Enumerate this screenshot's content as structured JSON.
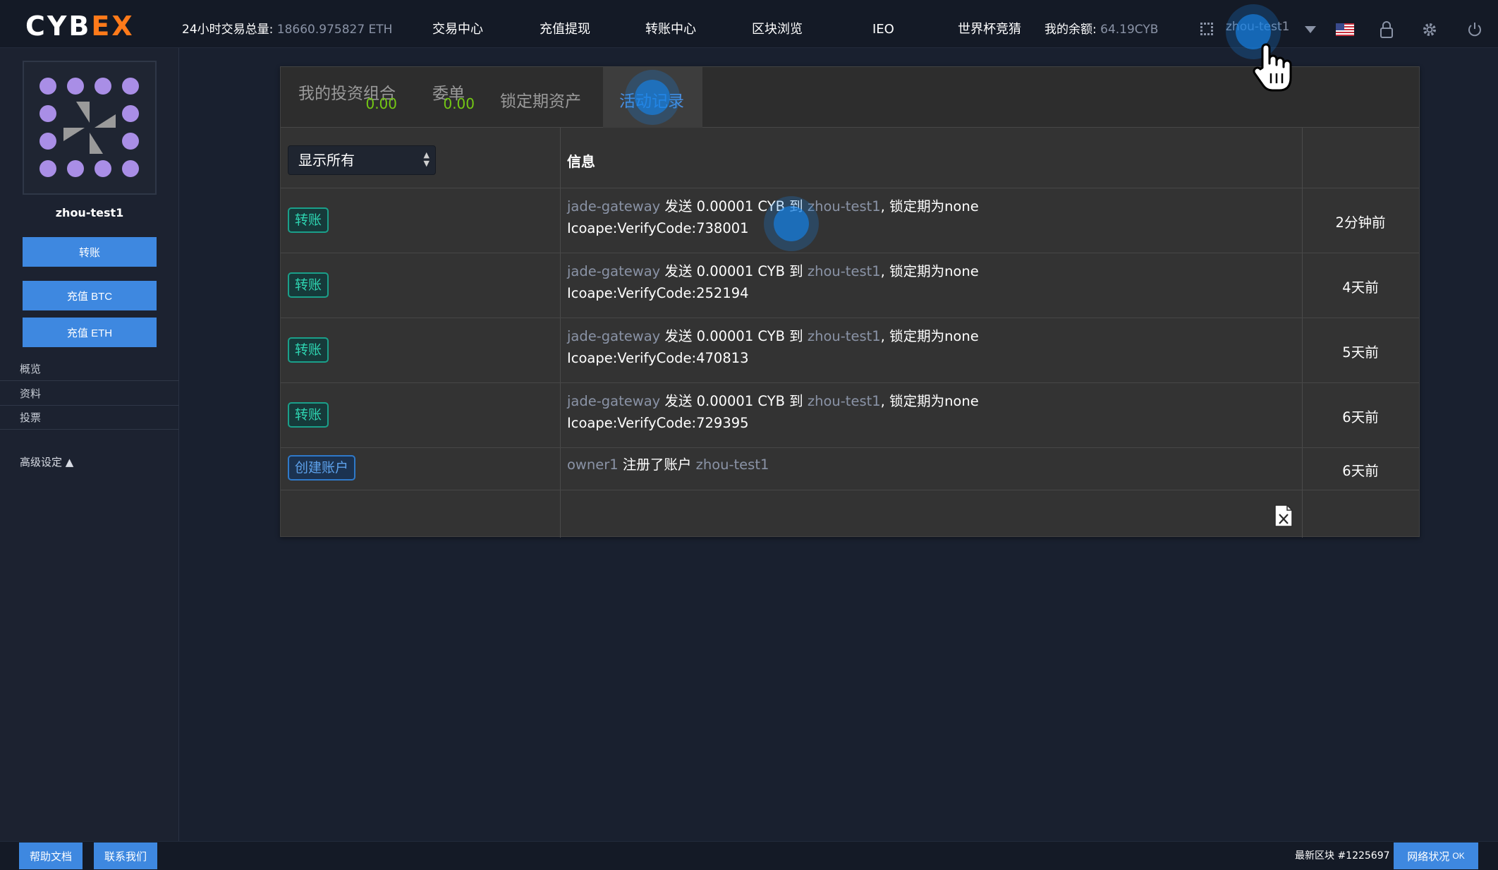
{
  "header": {
    "logo_main": "CYB",
    "logo_accent": "EX",
    "volume_label": "24小时交易总量:",
    "volume_value": "18660.975827 ETH",
    "nav": [
      "交易中心",
      "充值提现",
      "转账中心",
      "区块浏览",
      "IEO",
      "世界杯竞猜"
    ],
    "balance_label": "我的余额:",
    "balance_value": "64.19CYB",
    "account_name": "zhou-test1",
    "icons": [
      "qr-grid-icon",
      "chevron-down-icon",
      "us-flag-icon",
      "lock-icon",
      "gear-icon",
      "power-icon"
    ]
  },
  "sidebar": {
    "username": "zhou-test1",
    "buttons": [
      "转账",
      "充值 BTC",
      "充值 ETH"
    ],
    "links": [
      "概览",
      "资料",
      "投票"
    ],
    "advanced": "高级设定 ▲"
  },
  "tabs": [
    {
      "label": "我的投资组合",
      "value": "0.00"
    },
    {
      "label": "委单",
      "value": "0.00"
    },
    {
      "label": "锁定期资产",
      "value": ""
    },
    {
      "label": "活动记录",
      "value": ""
    }
  ],
  "active_tab": "活动记录",
  "filter": {
    "selected": "显示所有"
  },
  "table": {
    "info_header": "信息",
    "rows": [
      {
        "type": "转账",
        "from": "jade-gateway",
        "verb": "发送 0.00001 CYB 到",
        "to": "zhou-test1",
        "suffix": ", 锁定期为none",
        "memo": "Icoape:VerifyCode:738001",
        "time": "2分钟前"
      },
      {
        "type": "转账",
        "from": "jade-gateway",
        "verb": "发送 0.00001 CYB 到",
        "to": "zhou-test1",
        "suffix": ", 锁定期为none",
        "memo": "Icoape:VerifyCode:252194",
        "time": "4天前"
      },
      {
        "type": "转账",
        "from": "jade-gateway",
        "verb": "发送 0.00001 CYB 到",
        "to": "zhou-test1",
        "suffix": ", 锁定期为none",
        "memo": "Icoape:VerifyCode:470813",
        "time": "5天前"
      },
      {
        "type": "转账",
        "from": "jade-gateway",
        "verb": "发送 0.00001 CYB 到",
        "to": "zhou-test1",
        "suffix": ", 锁定期为none",
        "memo": "Icoape:VerifyCode:729395",
        "time": "6天前"
      },
      {
        "type": "创建账户",
        "from": "owner1",
        "verb": "注册了账户",
        "to": "zhou-test1",
        "suffix": "",
        "memo": "",
        "time": "6天前"
      }
    ]
  },
  "footer": {
    "help": "帮助文档",
    "contact": "联系我们",
    "latest_block": "最新区块 #1225697",
    "network": "网络状况",
    "network_status": "OK"
  },
  "colors": {
    "accent": "#3e88e0",
    "logo_accent": "#ff7a1a",
    "positive": "#74c814",
    "transfer_badge": "#2ed3b0",
    "create_badge": "#5ea2ec"
  }
}
